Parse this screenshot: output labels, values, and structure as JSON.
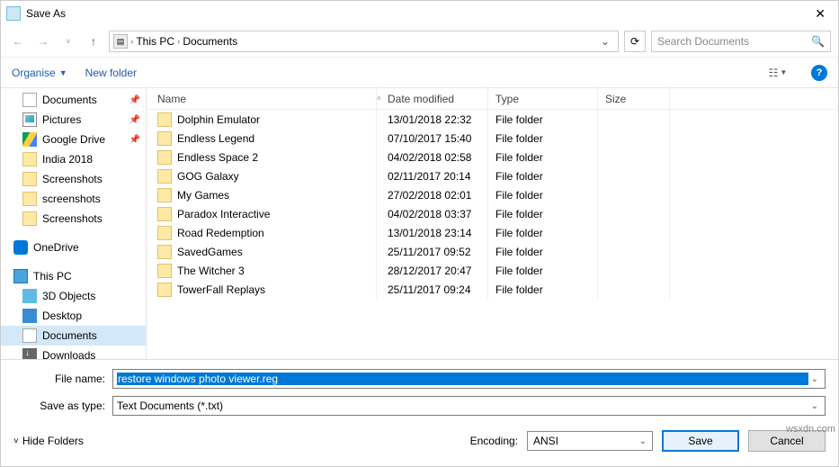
{
  "window": {
    "title": "Save As"
  },
  "nav": {
    "breadcrumb": {
      "root": "This PC",
      "current": "Documents"
    },
    "search_placeholder": "Search Documents"
  },
  "toolbar": {
    "organise": "Organise",
    "new_folder": "New folder"
  },
  "tree": {
    "items": [
      {
        "label": "Documents",
        "icon": "i-docs",
        "pinned": true
      },
      {
        "label": "Pictures",
        "icon": "i-pics",
        "pinned": true
      },
      {
        "label": "Google Drive",
        "icon": "i-gdrive",
        "pinned": true
      },
      {
        "label": "India 2018",
        "icon": "i-folder",
        "pinned": false
      },
      {
        "label": "Screenshots",
        "icon": "i-folder",
        "pinned": false
      },
      {
        "label": "screenshots",
        "icon": "i-folder",
        "pinned": false
      },
      {
        "label": "Screenshots",
        "icon": "i-folder",
        "pinned": false
      }
    ],
    "onedrive": "OneDrive",
    "thispc": "This PC",
    "pc_items": [
      {
        "label": "3D Objects",
        "icon": "i-3d"
      },
      {
        "label": "Desktop",
        "icon": "i-desk"
      },
      {
        "label": "Documents",
        "icon": "i-docs",
        "selected": true
      },
      {
        "label": "Downloads",
        "icon": "i-down"
      }
    ]
  },
  "columns": {
    "name": "Name",
    "date": "Date modified",
    "type": "Type",
    "size": "Size"
  },
  "files": [
    {
      "name": "Dolphin Emulator",
      "date": "13/01/2018 22:32",
      "type": "File folder"
    },
    {
      "name": "Endless Legend",
      "date": "07/10/2017 15:40",
      "type": "File folder"
    },
    {
      "name": "Endless Space 2",
      "date": "04/02/2018 02:58",
      "type": "File folder"
    },
    {
      "name": "GOG Galaxy",
      "date": "02/11/2017 20:14",
      "type": "File folder"
    },
    {
      "name": "My Games",
      "date": "27/02/2018 02:01",
      "type": "File folder"
    },
    {
      "name": "Paradox Interactive",
      "date": "04/02/2018 03:37",
      "type": "File folder"
    },
    {
      "name": "Road Redemption",
      "date": "13/01/2018 23:14",
      "type": "File folder"
    },
    {
      "name": "SavedGames",
      "date": "25/11/2017 09:52",
      "type": "File folder"
    },
    {
      "name": "The Witcher 3",
      "date": "28/12/2017 20:47",
      "type": "File folder"
    },
    {
      "name": "TowerFall Replays",
      "date": "25/11/2017 09:24",
      "type": "File folder"
    }
  ],
  "fields": {
    "filename_label": "File name:",
    "filename_value": "restore windows photo viewer.reg",
    "type_label": "Save as type:",
    "type_value": "Text Documents (*.txt)"
  },
  "footer": {
    "hide": "Hide Folders",
    "encoding_label": "Encoding:",
    "encoding_value": "ANSI",
    "save": "Save",
    "cancel": "Cancel"
  },
  "watermark": "wsxdn.com"
}
